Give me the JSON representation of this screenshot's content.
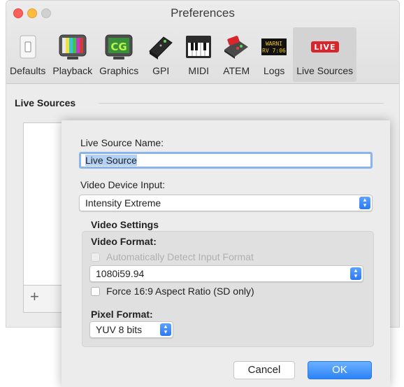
{
  "window": {
    "title": "Preferences"
  },
  "toolbar": {
    "items": [
      {
        "label": "Defaults",
        "icon": "switch-icon"
      },
      {
        "label": "Playback",
        "icon": "tv-icon"
      },
      {
        "label": "Graphics",
        "icon": "cg-icon"
      },
      {
        "label": "GPI",
        "icon": "gpi-device-icon"
      },
      {
        "label": "MIDI",
        "icon": "keyboard-icon"
      },
      {
        "label": "ATEM",
        "icon": "atem-switcher-icon"
      },
      {
        "label": "Logs",
        "icon": "log-display-icon",
        "icon_text": "WARNI\nRV 7:06"
      },
      {
        "label": "Live Sources",
        "icon": "live-badge-icon",
        "icon_text": "LIVE",
        "active": true
      }
    ]
  },
  "section": {
    "title": "Live Sources"
  },
  "list": {
    "add_label": "+"
  },
  "sheet": {
    "name_label": "Live Source Name:",
    "name_value": "Live Source",
    "device_label": "Video Device Input:",
    "device_value": "Intensity Extreme",
    "video_settings_label": "Video Settings",
    "video_format_label": "Video Format:",
    "auto_detect_label": "Automatically Detect Input Format",
    "format_value": "1080i59.94",
    "force_aspect_label": "Force 16:9 Aspect Ratio (SD only)",
    "pixel_format_label": "Pixel Format:",
    "pixel_format_value": "YUV 8 bits",
    "cancel_label": "Cancel",
    "ok_label": "OK"
  },
  "colors": {
    "accent": "#2d84f6",
    "live_red": "#d9262c"
  }
}
